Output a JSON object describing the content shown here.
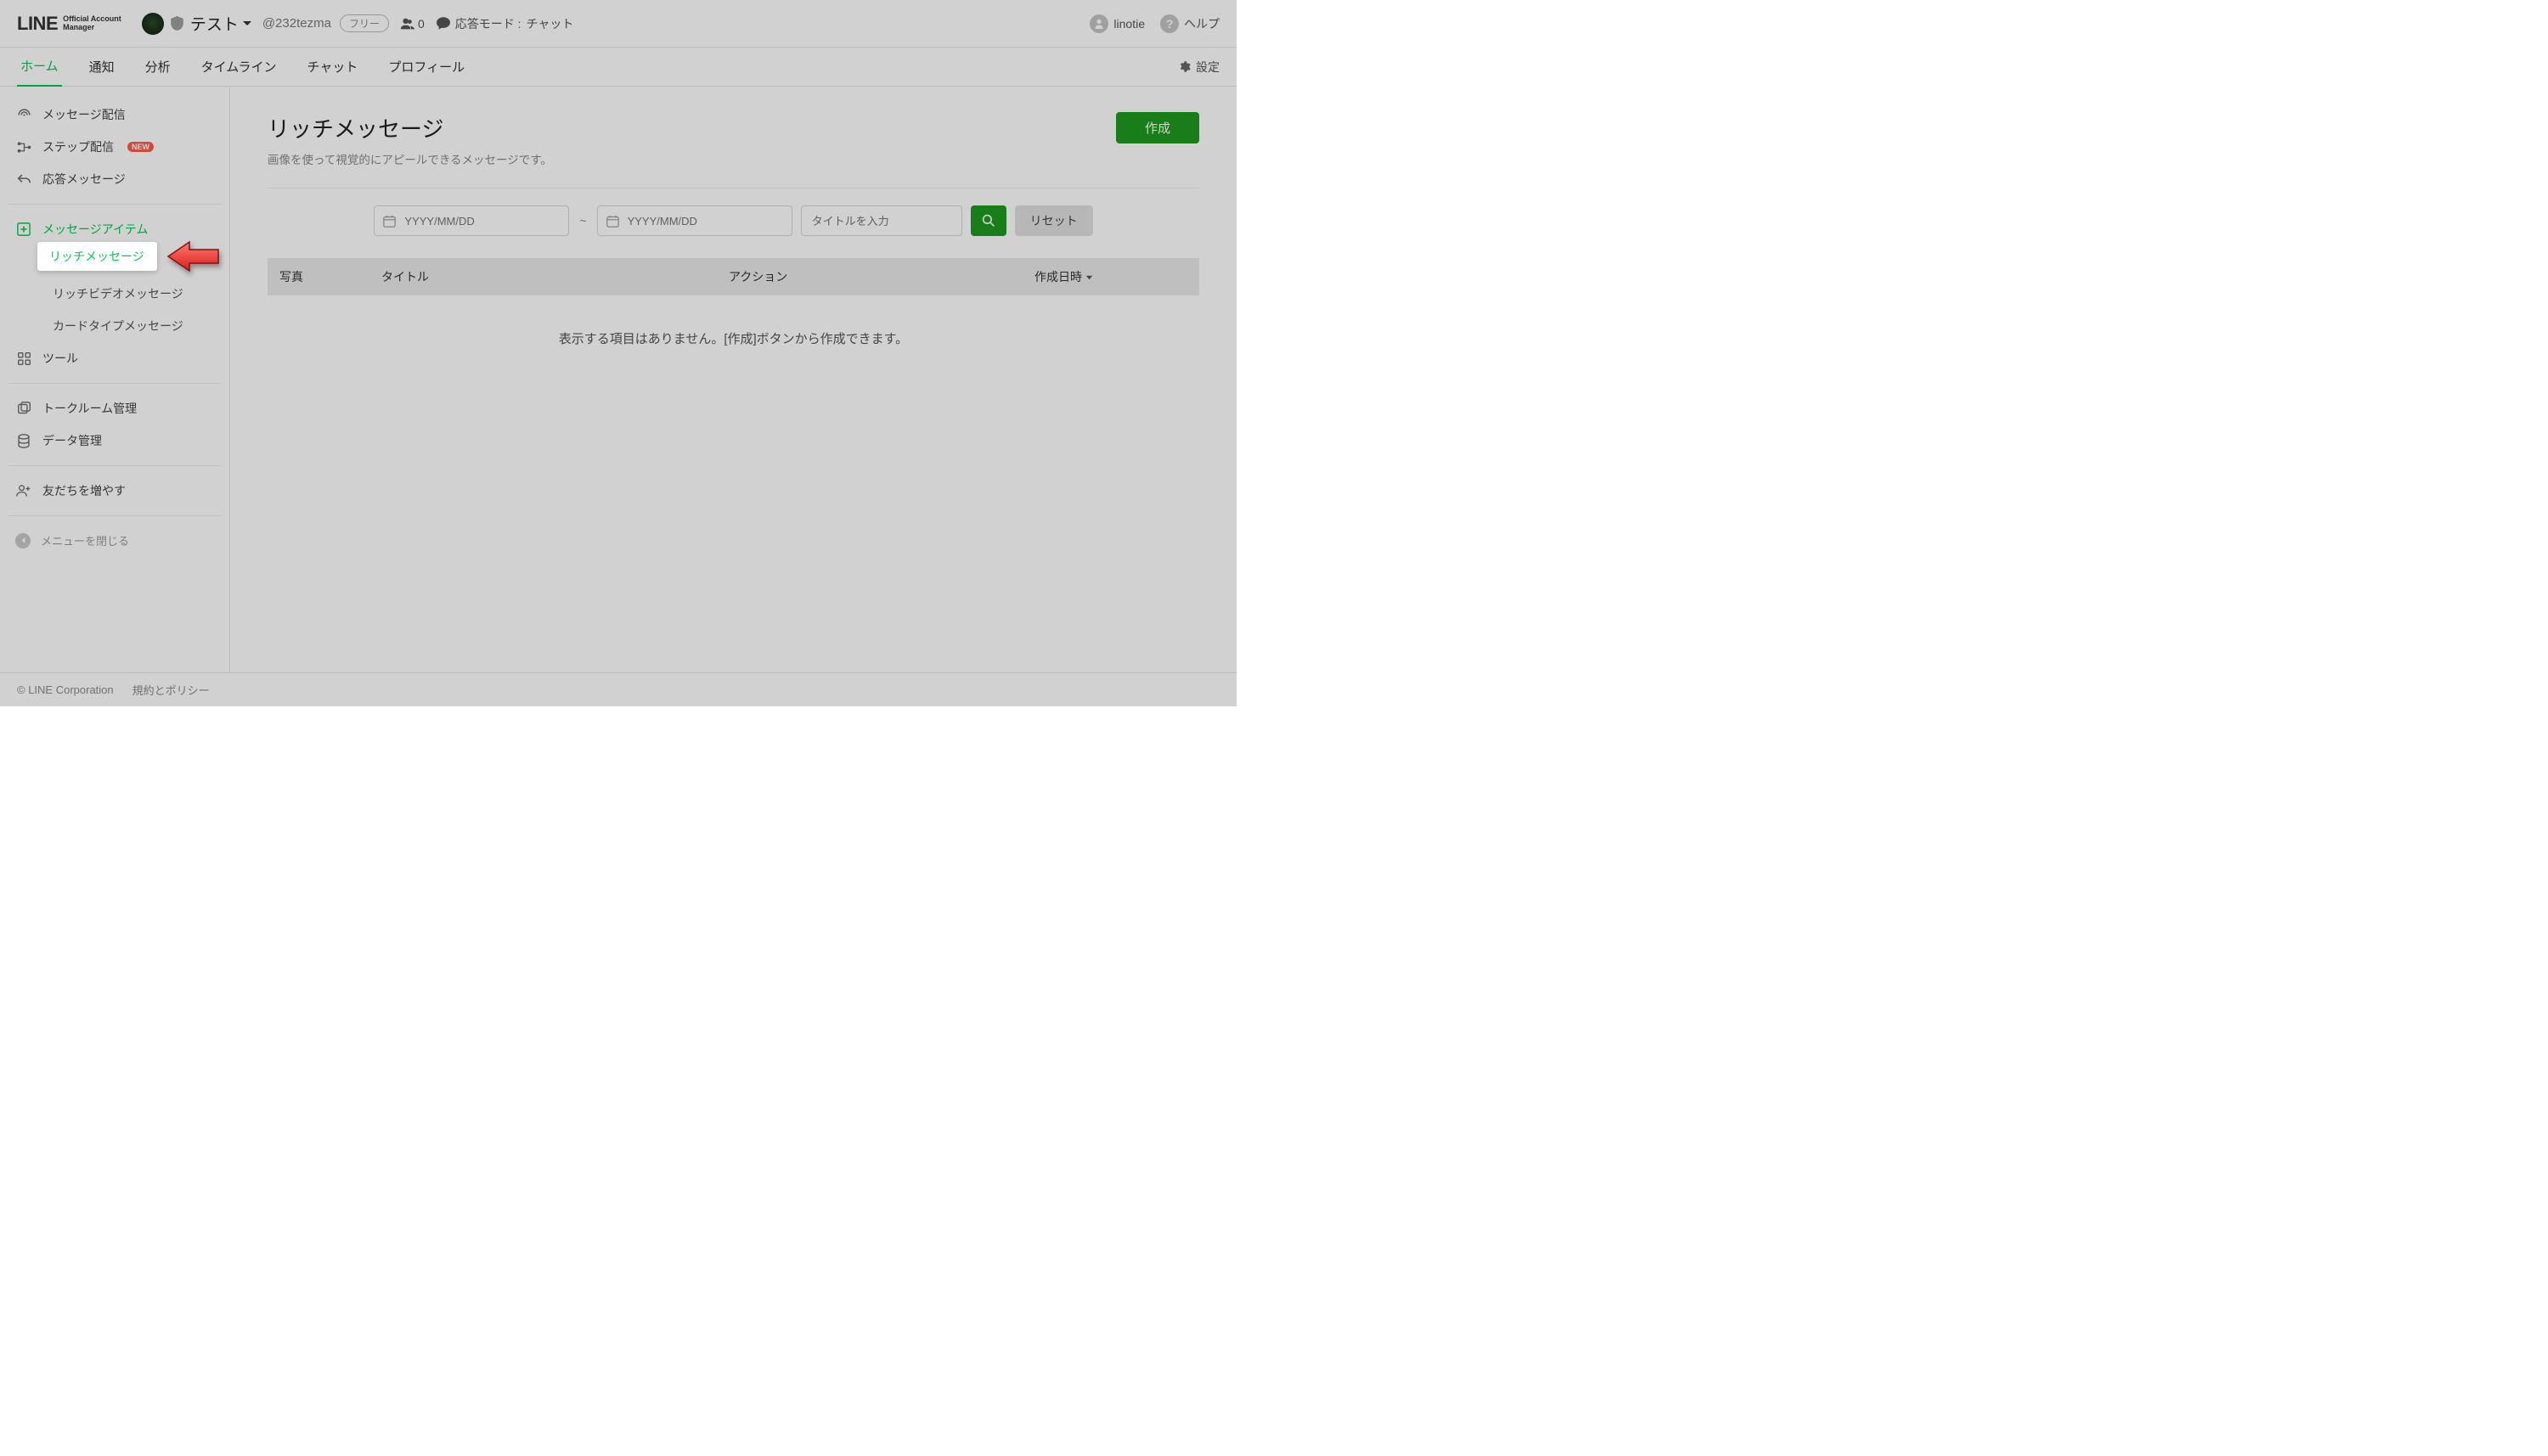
{
  "brand": {
    "name": "LINE",
    "sub1": "Official Account",
    "sub2": "Manager"
  },
  "header": {
    "account_name": "テスト",
    "account_id": "@232tezma",
    "plan": "フリー",
    "followers": "0",
    "response_mode_label": "応答モード :",
    "response_mode_value": "チャット",
    "username": "linotie",
    "help": "ヘルプ"
  },
  "nav": {
    "items": [
      "ホーム",
      "通知",
      "分析",
      "タイムライン",
      "チャット",
      "プロフィール"
    ],
    "settings": "設定"
  },
  "sidebar": {
    "broadcast": "メッセージ配信",
    "step": "ステップ配信",
    "new_badge": "NEW",
    "auto_response": "応答メッセージ",
    "message_items": "メッセージアイテム",
    "rich_message": "リッチメッセージ",
    "rich_video": "リッチビデオメッセージ",
    "card_type": "カードタイプメッセージ",
    "tools": "ツール",
    "talkroom": "トークルーム管理",
    "data_mgmt": "データ管理",
    "gain_friends": "友だちを増やす",
    "collapse": "メニューを閉じる"
  },
  "page": {
    "title": "リッチメッセージ",
    "description": "画像を使って視覚的にアピールできるメッセージです。",
    "create": "作成"
  },
  "filter": {
    "date_placeholder": "YYYY/MM/DD",
    "tilde": "~",
    "title_placeholder": "タイトルを入力",
    "reset": "リセット"
  },
  "table": {
    "photo": "写真",
    "title": "タイトル",
    "action": "アクション",
    "created": "作成日時",
    "empty": "表示する項目はありません。[作成]ボタンから作成できます。"
  },
  "footer": {
    "copyright": "© LINE Corporation",
    "policy": "規約とポリシー"
  }
}
